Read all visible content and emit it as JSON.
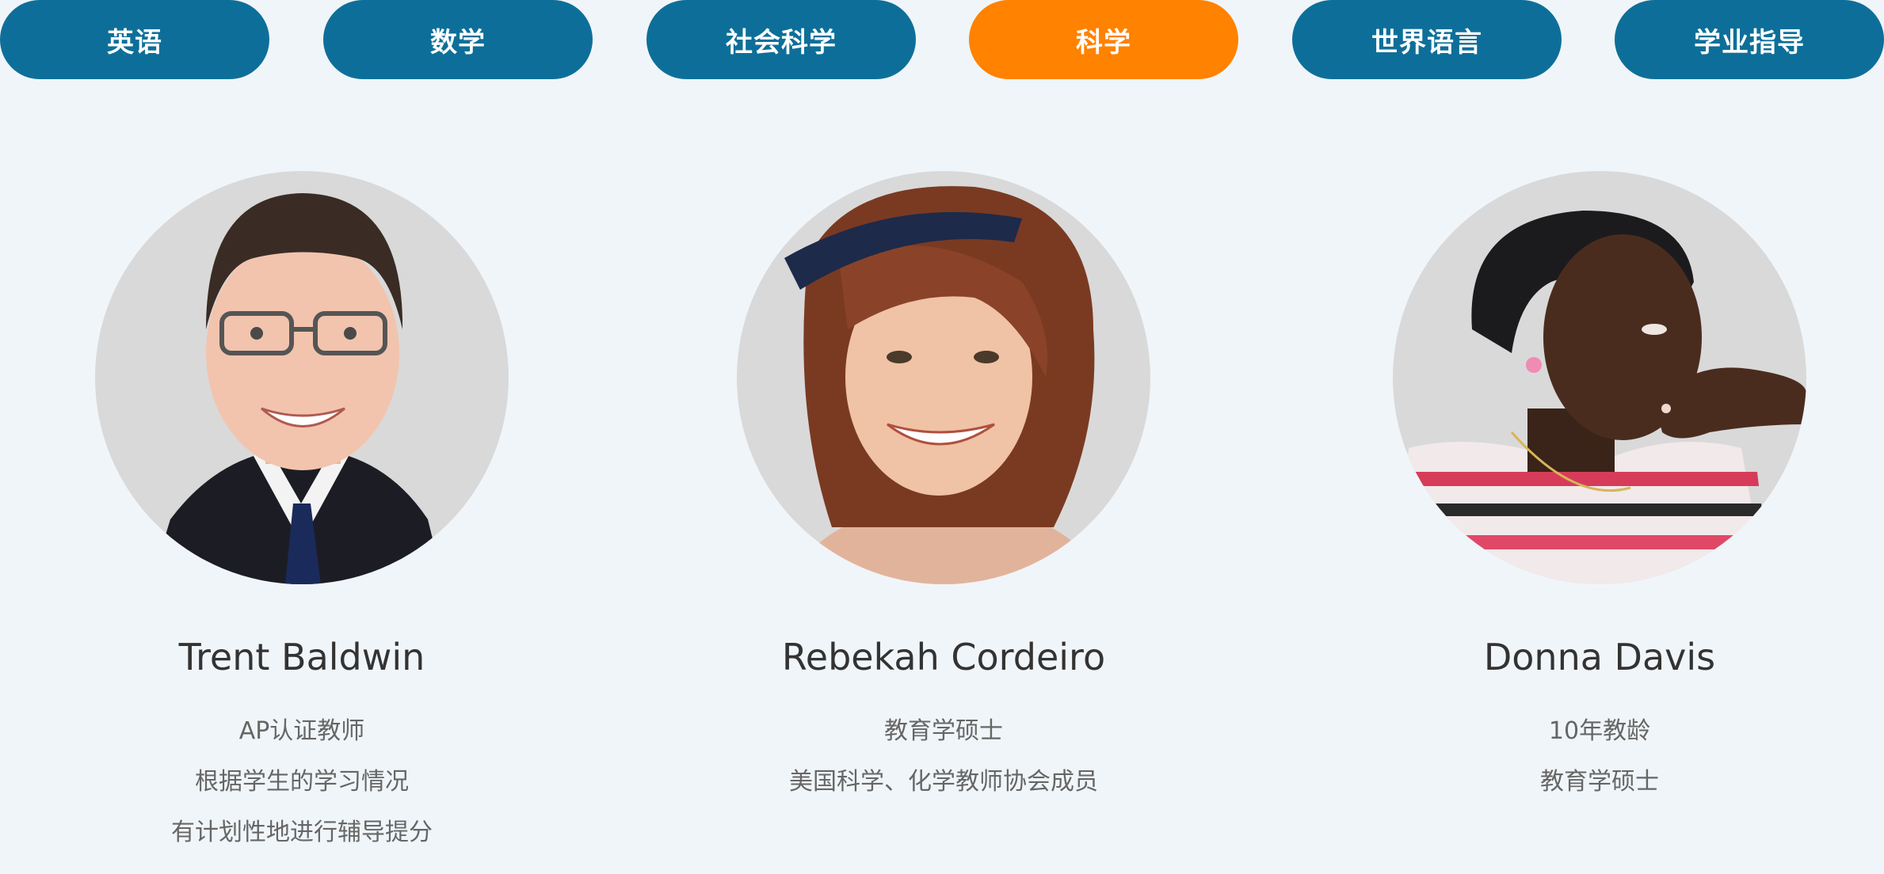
{
  "tabs": [
    {
      "label": "英语",
      "active": false
    },
    {
      "label": "数学",
      "active": false
    },
    {
      "label": "社会科学",
      "active": false
    },
    {
      "label": "科学",
      "active": true
    },
    {
      "label": "世界语言",
      "active": false
    },
    {
      "label": "学业指导",
      "active": false
    }
  ],
  "colors": {
    "tab": "#0d6f99",
    "tab_active": "#ff8200",
    "background": "#f0f5f9",
    "avatar_bg": "#d9d9d9",
    "name": "#333333",
    "desc": "#666666"
  },
  "teachers": [
    {
      "name": "Trent Baldwin",
      "desc": [
        "AP认证教师",
        "根据学生的学习情况",
        "有计划性地进行辅导提分"
      ]
    },
    {
      "name": "Rebekah Cordeiro",
      "desc": [
        "教育学硕士",
        "美国科学、化学教师协会成员"
      ]
    },
    {
      "name": "Donna Davis",
      "desc": [
        "10年教龄",
        "教育学硕士"
      ]
    }
  ]
}
